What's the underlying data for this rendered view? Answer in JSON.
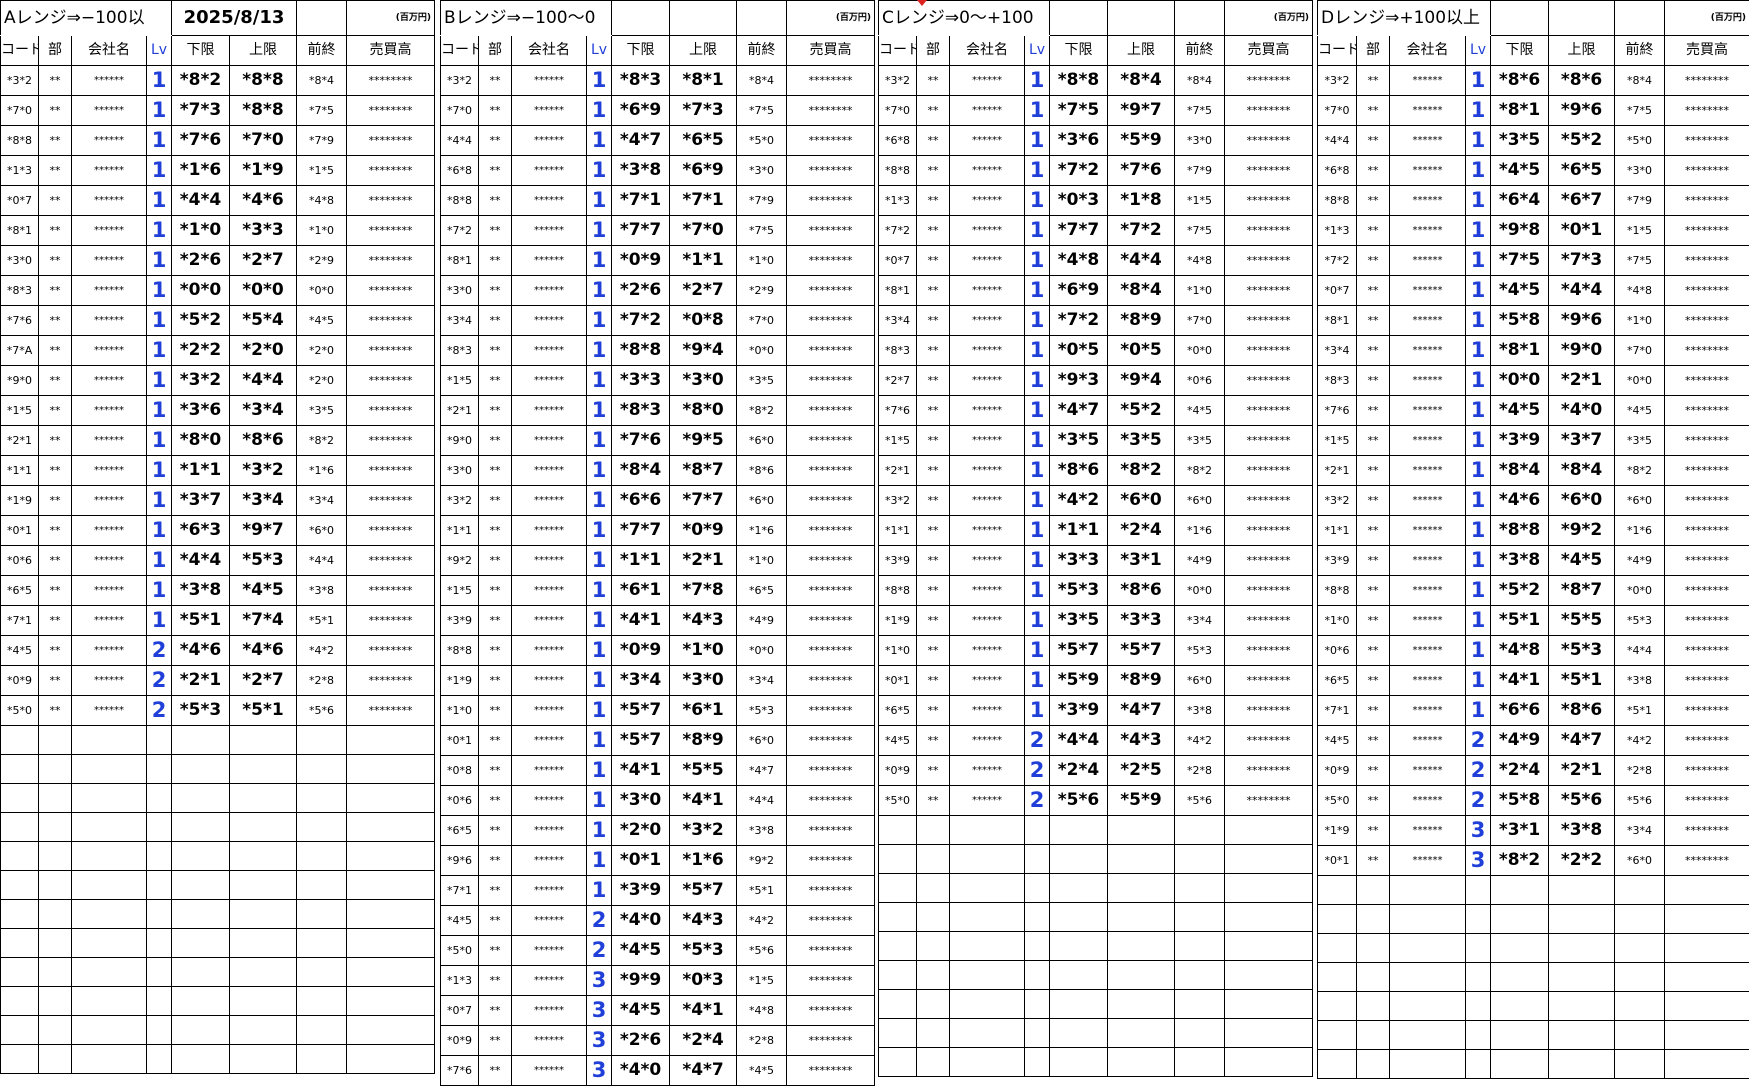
{
  "headers": [
    "コード",
    "部",
    "会社名",
    "Lv",
    "下限",
    "上限",
    "前終",
    "売買高"
  ],
  "unit": "(百万円)",
  "date": "2025/8/13",
  "total_rows": 34,
  "sections": [
    {
      "id": "a",
      "title": "Aレンジ⇒−100以",
      "rows": [
        [
          "*3*2",
          "**",
          "******",
          "1",
          "*8*2",
          "*8*8",
          "*8*4",
          "********"
        ],
        [
          "*7*0",
          "**",
          "******",
          "1",
          "*7*3",
          "*8*8",
          "*7*5",
          "********"
        ],
        [
          "*8*8",
          "**",
          "******",
          "1",
          "*7*6",
          "*7*0",
          "*7*9",
          "********"
        ],
        [
          "*1*3",
          "**",
          "******",
          "1",
          "*1*6",
          "*1*9",
          "*1*5",
          "********"
        ],
        [
          "*0*7",
          "**",
          "******",
          "1",
          "*4*4",
          "*4*6",
          "*4*8",
          "********"
        ],
        [
          "*8*1",
          "**",
          "******",
          "1",
          "*1*0",
          "*3*3",
          "*1*0",
          "********"
        ],
        [
          "*3*0",
          "**",
          "******",
          "1",
          "*2*6",
          "*2*7",
          "*2*9",
          "********"
        ],
        [
          "*8*3",
          "**",
          "******",
          "1",
          "*0*0",
          "*0*0",
          "*0*0",
          "********"
        ],
        [
          "*7*6",
          "**",
          "******",
          "1",
          "*5*2",
          "*5*4",
          "*4*5",
          "********"
        ],
        [
          "*7*A",
          "**",
          "******",
          "1",
          "*2*2",
          "*2*0",
          "*2*0",
          "********"
        ],
        [
          "*9*0",
          "**",
          "******",
          "1",
          "*3*2",
          "*4*4",
          "*2*0",
          "********"
        ],
        [
          "*1*5",
          "**",
          "******",
          "1",
          "*3*6",
          "*3*4",
          "*3*5",
          "********"
        ],
        [
          "*2*1",
          "**",
          "******",
          "1",
          "*8*0",
          "*8*6",
          "*8*2",
          "********"
        ],
        [
          "*1*1",
          "**",
          "******",
          "1",
          "*1*1",
          "*3*2",
          "*1*6",
          "********"
        ],
        [
          "*1*9",
          "**",
          "******",
          "1",
          "*3*7",
          "*3*4",
          "*3*4",
          "********"
        ],
        [
          "*0*1",
          "**",
          "******",
          "1",
          "*6*3",
          "*9*7",
          "*6*0",
          "********"
        ],
        [
          "*0*6",
          "**",
          "******",
          "1",
          "*4*4",
          "*5*3",
          "*4*4",
          "********"
        ],
        [
          "*6*5",
          "**",
          "******",
          "1",
          "*3*8",
          "*4*5",
          "*3*8",
          "********"
        ],
        [
          "*7*1",
          "**",
          "******",
          "1",
          "*5*1",
          "*7*4",
          "*5*1",
          "********"
        ],
        [
          "*4*5",
          "**",
          "******",
          "2",
          "*4*6",
          "*4*6",
          "*4*2",
          "********"
        ],
        [
          "*0*9",
          "**",
          "******",
          "2",
          "*2*1",
          "*2*7",
          "*2*8",
          "********"
        ],
        [
          "*5*0",
          "**",
          "******",
          "2",
          "*5*3",
          "*5*1",
          "*5*6",
          "********"
        ]
      ]
    },
    {
      "id": "b",
      "title": "Bレンジ⇒−100〜0",
      "rows": [
        [
          "*3*2",
          "**",
          "******",
          "1",
          "*8*3",
          "*8*1",
          "*8*4",
          "********"
        ],
        [
          "*7*0",
          "**",
          "******",
          "1",
          "*6*9",
          "*7*3",
          "*7*5",
          "********"
        ],
        [
          "*4*4",
          "**",
          "******",
          "1",
          "*4*7",
          "*6*5",
          "*5*0",
          "********"
        ],
        [
          "*6*8",
          "**",
          "******",
          "1",
          "*3*8",
          "*6*9",
          "*3*0",
          "********"
        ],
        [
          "*8*8",
          "**",
          "******",
          "1",
          "*7*1",
          "*7*1",
          "*7*9",
          "********"
        ],
        [
          "*7*2",
          "**",
          "******",
          "1",
          "*7*7",
          "*7*0",
          "*7*5",
          "********"
        ],
        [
          "*8*1",
          "**",
          "******",
          "1",
          "*0*9",
          "*1*1",
          "*1*0",
          "********"
        ],
        [
          "*3*0",
          "**",
          "******",
          "1",
          "*2*6",
          "*2*7",
          "*2*9",
          "********"
        ],
        [
          "*3*4",
          "**",
          "******",
          "1",
          "*7*2",
          "*0*8",
          "*7*0",
          "********"
        ],
        [
          "*8*3",
          "**",
          "******",
          "1",
          "*8*8",
          "*9*4",
          "*0*0",
          "********"
        ],
        [
          "*1*5",
          "**",
          "******",
          "1",
          "*3*3",
          "*3*0",
          "*3*5",
          "********"
        ],
        [
          "*2*1",
          "**",
          "******",
          "1",
          "*8*3",
          "*8*0",
          "*8*2",
          "********"
        ],
        [
          "*9*0",
          "**",
          "******",
          "1",
          "*7*6",
          "*9*5",
          "*6*0",
          "********"
        ],
        [
          "*3*0",
          "**",
          "******",
          "1",
          "*8*4",
          "*8*7",
          "*8*6",
          "********"
        ],
        [
          "*3*2",
          "**",
          "******",
          "1",
          "*6*6",
          "*7*7",
          "*6*0",
          "********"
        ],
        [
          "*1*1",
          "**",
          "******",
          "1",
          "*7*7",
          "*0*9",
          "*1*6",
          "********"
        ],
        [
          "*9*2",
          "**",
          "******",
          "1",
          "*1*1",
          "*2*1",
          "*1*0",
          "********"
        ],
        [
          "*1*5",
          "**",
          "******",
          "1",
          "*6*1",
          "*7*8",
          "*6*5",
          "********"
        ],
        [
          "*3*9",
          "**",
          "******",
          "1",
          "*4*1",
          "*4*3",
          "*4*9",
          "********"
        ],
        [
          "*8*8",
          "**",
          "******",
          "1",
          "*0*9",
          "*1*0",
          "*0*0",
          "********"
        ],
        [
          "*1*9",
          "**",
          "******",
          "1",
          "*3*4",
          "*3*0",
          "*3*4",
          "********"
        ],
        [
          "*1*0",
          "**",
          "******",
          "1",
          "*5*7",
          "*6*1",
          "*5*3",
          "********"
        ],
        [
          "*0*1",
          "**",
          "******",
          "1",
          "*5*7",
          "*8*9",
          "*6*0",
          "********"
        ],
        [
          "*0*8",
          "**",
          "******",
          "1",
          "*4*1",
          "*5*5",
          "*4*7",
          "********"
        ],
        [
          "*0*6",
          "**",
          "******",
          "1",
          "*3*0",
          "*4*1",
          "*4*4",
          "********"
        ],
        [
          "*6*5",
          "**",
          "******",
          "1",
          "*2*0",
          "*3*2",
          "*3*8",
          "********"
        ],
        [
          "*9*6",
          "**",
          "******",
          "1",
          "*0*1",
          "*1*6",
          "*9*2",
          "********"
        ],
        [
          "*7*1",
          "**",
          "******",
          "1",
          "*3*9",
          "*5*7",
          "*5*1",
          "********"
        ],
        [
          "*4*5",
          "**",
          "******",
          "2",
          "*4*0",
          "*4*3",
          "*4*2",
          "********"
        ],
        [
          "*5*0",
          "**",
          "******",
          "2",
          "*4*5",
          "*5*3",
          "*5*6",
          "********"
        ],
        [
          "*1*3",
          "**",
          "******",
          "3",
          "*9*9",
          "*0*3",
          "*1*5",
          "********"
        ],
        [
          "*0*7",
          "**",
          "******",
          "3",
          "*4*5",
          "*4*1",
          "*4*8",
          "********"
        ],
        [
          "*0*9",
          "**",
          "******",
          "3",
          "*2*6",
          "*2*4",
          "*2*8",
          "********"
        ],
        [
          "*7*6",
          "**",
          "******",
          "3",
          "*4*0",
          "*4*7",
          "*4*5",
          "********"
        ]
      ]
    },
    {
      "id": "c",
      "title": "Cレンジ⇒0〜+100",
      "rows": [
        [
          "*3*2",
          "**",
          "******",
          "1",
          "*8*8",
          "*8*4",
          "*8*4",
          "********"
        ],
        [
          "*7*0",
          "**",
          "******",
          "1",
          "*7*5",
          "*9*7",
          "*7*5",
          "********"
        ],
        [
          "*6*8",
          "**",
          "******",
          "1",
          "*3*6",
          "*5*9",
          "*3*0",
          "********"
        ],
        [
          "*8*8",
          "**",
          "******",
          "1",
          "*7*2",
          "*7*6",
          "*7*9",
          "********"
        ],
        [
          "*1*3",
          "**",
          "******",
          "1",
          "*0*3",
          "*1*8",
          "*1*5",
          "********"
        ],
        [
          "*7*2",
          "**",
          "******",
          "1",
          "*7*7",
          "*7*2",
          "*7*5",
          "********"
        ],
        [
          "*0*7",
          "**",
          "******",
          "1",
          "*4*8",
          "*4*4",
          "*4*8",
          "********"
        ],
        [
          "*8*1",
          "**",
          "******",
          "1",
          "*6*9",
          "*8*4",
          "*1*0",
          "********"
        ],
        [
          "*3*4",
          "**",
          "******",
          "1",
          "*7*2",
          "*8*9",
          "*7*0",
          "********"
        ],
        [
          "*8*3",
          "**",
          "******",
          "1",
          "*0*5",
          "*0*5",
          "*0*0",
          "********"
        ],
        [
          "*2*7",
          "**",
          "******",
          "1",
          "*9*3",
          "*9*4",
          "*0*6",
          "********"
        ],
        [
          "*7*6",
          "**",
          "******",
          "1",
          "*4*7",
          "*5*2",
          "*4*5",
          "********"
        ],
        [
          "*1*5",
          "**",
          "******",
          "1",
          "*3*5",
          "*3*5",
          "*3*5",
          "********"
        ],
        [
          "*2*1",
          "**",
          "******",
          "1",
          "*8*6",
          "*8*2",
          "*8*2",
          "********"
        ],
        [
          "*3*2",
          "**",
          "******",
          "1",
          "*4*2",
          "*6*0",
          "*6*0",
          "********"
        ],
        [
          "*1*1",
          "**",
          "******",
          "1",
          "*1*1",
          "*2*4",
          "*1*6",
          "********"
        ],
        [
          "*3*9",
          "**",
          "******",
          "1",
          "*3*3",
          "*3*1",
          "*4*9",
          "********"
        ],
        [
          "*8*8",
          "**",
          "******",
          "1",
          "*5*3",
          "*8*6",
          "*0*0",
          "********"
        ],
        [
          "*1*9",
          "**",
          "******",
          "1",
          "*3*5",
          "*3*3",
          "*3*4",
          "********"
        ],
        [
          "*1*0",
          "**",
          "******",
          "1",
          "*5*7",
          "*5*7",
          "*5*3",
          "********"
        ],
        [
          "*0*1",
          "**",
          "******",
          "1",
          "*5*9",
          "*8*9",
          "*6*0",
          "********"
        ],
        [
          "*6*5",
          "**",
          "******",
          "1",
          "*3*9",
          "*4*7",
          "*3*8",
          "********"
        ],
        [
          "*4*5",
          "**",
          "******",
          "2",
          "*4*4",
          "*4*3",
          "*4*2",
          "********"
        ],
        [
          "*0*9",
          "**",
          "******",
          "2",
          "*2*4",
          "*2*5",
          "*2*8",
          "********"
        ],
        [
          "*5*0",
          "**",
          "******",
          "2",
          "*5*6",
          "*5*9",
          "*5*6",
          "********"
        ]
      ]
    },
    {
      "id": "d",
      "title": "Dレンジ⇒+100以上",
      "rows": [
        [
          "*3*2",
          "**",
          "******",
          "1",
          "*8*6",
          "*8*6",
          "*8*4",
          "********"
        ],
        [
          "*7*0",
          "**",
          "******",
          "1",
          "*8*1",
          "*9*6",
          "*7*5",
          "********"
        ],
        [
          "*4*4",
          "**",
          "******",
          "1",
          "*3*5",
          "*5*2",
          "*5*0",
          "********"
        ],
        [
          "*6*8",
          "**",
          "******",
          "1",
          "*4*5",
          "*6*5",
          "*3*0",
          "********"
        ],
        [
          "*8*8",
          "**",
          "******",
          "1",
          "*6*4",
          "*6*7",
          "*7*9",
          "********"
        ],
        [
          "*1*3",
          "**",
          "******",
          "1",
          "*9*8",
          "*0*1",
          "*1*5",
          "********"
        ],
        [
          "*7*2",
          "**",
          "******",
          "1",
          "*7*5",
          "*7*3",
          "*7*5",
          "********"
        ],
        [
          "*0*7",
          "**",
          "******",
          "1",
          "*4*5",
          "*4*4",
          "*4*8",
          "********"
        ],
        [
          "*8*1",
          "**",
          "******",
          "1",
          "*5*8",
          "*9*6",
          "*1*0",
          "********"
        ],
        [
          "*3*4",
          "**",
          "******",
          "1",
          "*8*1",
          "*9*0",
          "*7*0",
          "********"
        ],
        [
          "*8*3",
          "**",
          "******",
          "1",
          "*0*0",
          "*2*1",
          "*0*0",
          "********"
        ],
        [
          "*7*6",
          "**",
          "******",
          "1",
          "*4*5",
          "*4*0",
          "*4*5",
          "********"
        ],
        [
          "*1*5",
          "**",
          "******",
          "1",
          "*3*9",
          "*3*7",
          "*3*5",
          "********"
        ],
        [
          "*2*1",
          "**",
          "******",
          "1",
          "*8*4",
          "*8*4",
          "*8*2",
          "********"
        ],
        [
          "*3*2",
          "**",
          "******",
          "1",
          "*4*6",
          "*6*0",
          "*6*0",
          "********"
        ],
        [
          "*1*1",
          "**",
          "******",
          "1",
          "*8*8",
          "*9*2",
          "*1*6",
          "********"
        ],
        [
          "*3*9",
          "**",
          "******",
          "1",
          "*3*8",
          "*4*5",
          "*4*9",
          "********"
        ],
        [
          "*8*8",
          "**",
          "******",
          "1",
          "*5*2",
          "*8*7",
          "*0*0",
          "********"
        ],
        [
          "*1*0",
          "**",
          "******",
          "1",
          "*5*1",
          "*5*5",
          "*5*3",
          "********"
        ],
        [
          "*0*6",
          "**",
          "******",
          "1",
          "*4*8",
          "*5*3",
          "*4*4",
          "********"
        ],
        [
          "*6*5",
          "**",
          "******",
          "1",
          "*4*1",
          "*5*1",
          "*3*8",
          "********"
        ],
        [
          "*7*1",
          "**",
          "******",
          "1",
          "*6*6",
          "*8*6",
          "*5*1",
          "********"
        ],
        [
          "*4*5",
          "**",
          "******",
          "2",
          "*4*9",
          "*4*7",
          "*4*2",
          "********"
        ],
        [
          "*0*9",
          "**",
          "******",
          "2",
          "*2*4",
          "*2*1",
          "*2*8",
          "********"
        ],
        [
          "*5*0",
          "**",
          "******",
          "2",
          "*5*8",
          "*5*6",
          "*5*6",
          "********"
        ],
        [
          "*1*9",
          "**",
          "******",
          "3",
          "*3*1",
          "*3*8",
          "*3*4",
          "********"
        ],
        [
          "*0*1",
          "**",
          "******",
          "3",
          "*8*2",
          "*2*2",
          "*6*0",
          "********"
        ]
      ]
    }
  ]
}
